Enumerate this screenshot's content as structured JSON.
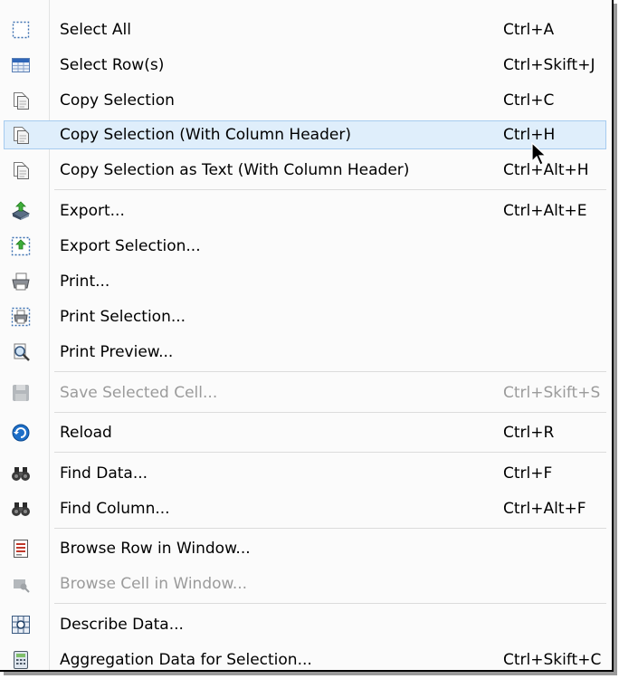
{
  "menu": {
    "items": [
      {
        "label": "Select All",
        "shortcut": "Ctrl+A",
        "icon": "select-all-icon"
      },
      {
        "label": "Select Row(s)",
        "shortcut": "Ctrl+Skift+J",
        "icon": "select-rows-icon"
      },
      {
        "label": "Copy Selection",
        "shortcut": "Ctrl+C",
        "icon": "copy-icon"
      },
      {
        "label": "Copy Selection (With Column Header)",
        "shortcut": "Ctrl+H",
        "icon": "copy-icon"
      },
      {
        "label": "Copy Selection as Text (With Column Header)",
        "shortcut": "Ctrl+Alt+H",
        "icon": "copy-icon"
      },
      {
        "label": "Export...",
        "shortcut": "Ctrl+Alt+E",
        "icon": "export-icon"
      },
      {
        "label": "Export Selection...",
        "shortcut": "",
        "icon": "export-selection-icon"
      },
      {
        "label": "Print...",
        "shortcut": "",
        "icon": "print-icon"
      },
      {
        "label": "Print Selection...",
        "shortcut": "",
        "icon": "print-selection-icon"
      },
      {
        "label": "Print Preview...",
        "shortcut": "",
        "icon": "print-preview-icon"
      },
      {
        "label": "Save Selected Cell...",
        "shortcut": "Ctrl+Skift+S",
        "icon": "save-cell-icon",
        "disabled": true
      },
      {
        "label": "Reload",
        "shortcut": "Ctrl+R",
        "icon": "reload-icon"
      },
      {
        "label": "Find Data...",
        "shortcut": "Ctrl+F",
        "icon": "binoculars-icon"
      },
      {
        "label": "Find Column...",
        "shortcut": "Ctrl+Alt+F",
        "icon": "binoculars-icon"
      },
      {
        "label": "Browse Row in Window...",
        "shortcut": "",
        "icon": "browse-row-icon"
      },
      {
        "label": "Browse Cell in Window...",
        "shortcut": "",
        "icon": "browse-cell-icon",
        "disabled": true
      },
      {
        "label": "Describe Data...",
        "shortcut": "",
        "icon": "describe-data-icon"
      },
      {
        "label": "Aggregation Data for Selection...",
        "shortcut": "Ctrl+Skift+C",
        "icon": "calculator-icon"
      }
    ],
    "highlighted_index": 3,
    "colors": {
      "highlight_bg": "#dfeefb",
      "highlight_border": "#a6cbef",
      "disabled_text": "#9b9b9b"
    }
  }
}
